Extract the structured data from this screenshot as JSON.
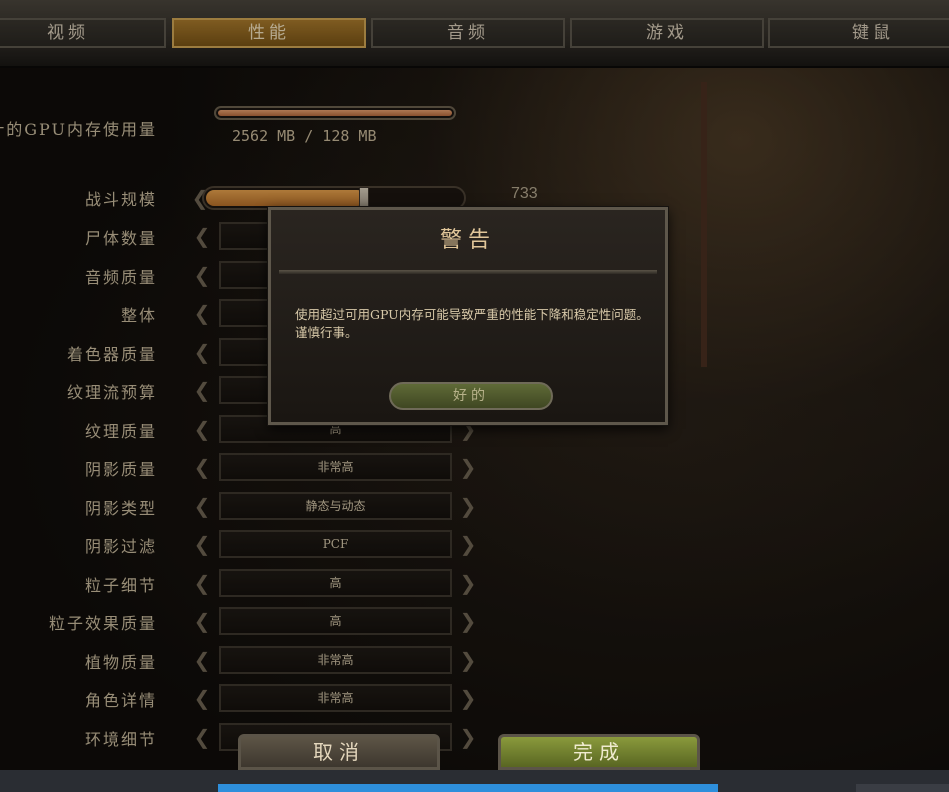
{
  "tabs": [
    "视频",
    "性能",
    "音频",
    "游戏",
    "键鼠"
  ],
  "active_tab": "性能",
  "gpu": {
    "label": "计的GPU内存使用量",
    "text": "2562 MB / 128 MB",
    "used_fraction": 1.0
  },
  "battle": {
    "label": "战斗规模",
    "value": "733",
    "fraction": 0.62
  },
  "settings": [
    {
      "label": "尸体数量",
      "value": ""
    },
    {
      "label": "音频质量",
      "value": ""
    },
    {
      "label": "整体",
      "value": ""
    },
    {
      "label": "着色器质量",
      "value": ""
    },
    {
      "label": "纹理流预算",
      "value": ""
    },
    {
      "label": "纹理质量",
      "value": "高"
    },
    {
      "label": "阴影质量",
      "value": "非常高"
    },
    {
      "label": "阴影类型",
      "value": "静态与动态"
    },
    {
      "label": "阴影过滤",
      "value": "PCF"
    },
    {
      "label": "粒子细节",
      "value": "高"
    },
    {
      "label": "粒子效果质量",
      "value": "高"
    },
    {
      "label": "植物质量",
      "value": "非常高"
    },
    {
      "label": "角色详情",
      "value": "非常高"
    },
    {
      "label": "环境细节",
      "value": ""
    }
  ],
  "dialog": {
    "title": "警告",
    "message_line1": "使用超过可用GPU内存可能导致严重的性能下降和稳定性问题。",
    "message_line2": "谨慎行事。",
    "ok_label": "好的"
  },
  "footer": {
    "cancel_label": "取消",
    "done_label": "完成"
  },
  "colors": {
    "accent": "#a97a2c",
    "done_button": "#8a9a3c",
    "taskbar_highlight": "#2e8fdc"
  }
}
